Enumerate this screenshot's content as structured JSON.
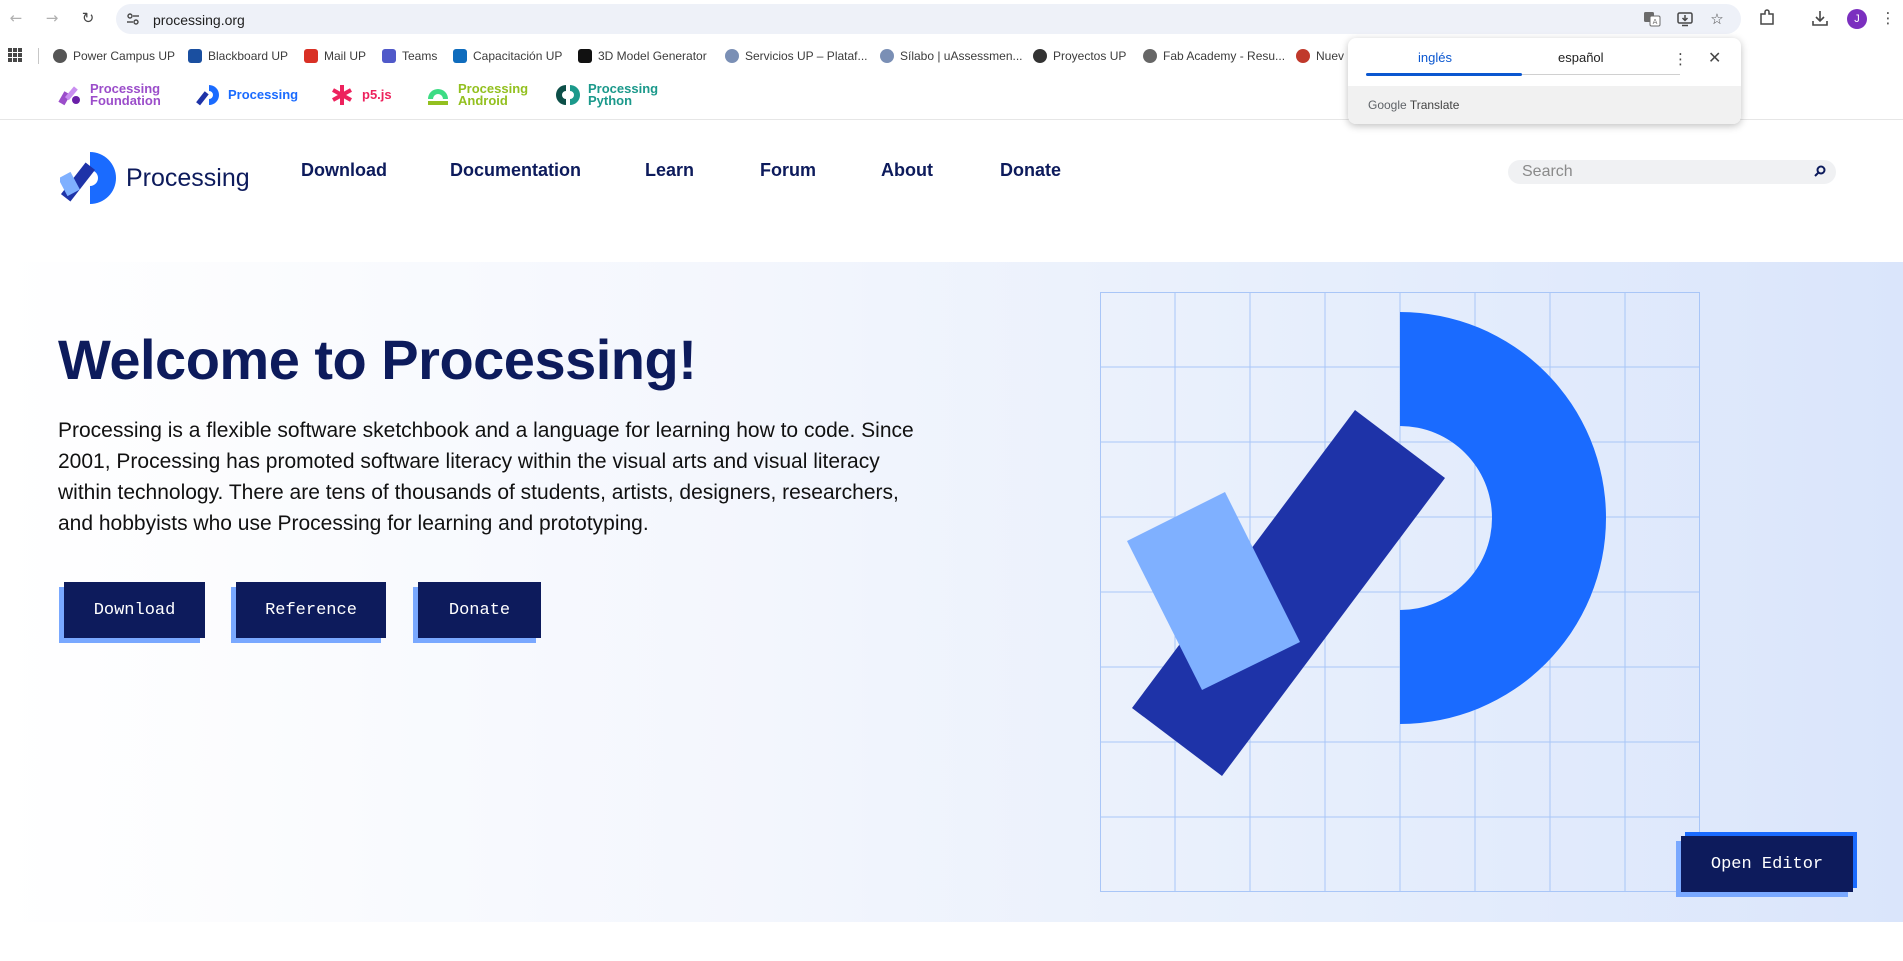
{
  "browser": {
    "url": "processing.org",
    "avatar_letter": "J",
    "icons": [
      "back-icon",
      "forward-icon",
      "reload-icon",
      "site-settings-icon",
      "translate-icon",
      "install-icon",
      "star-icon",
      "extensions-icon",
      "downloads-icon"
    ]
  },
  "bookmarks": [
    {
      "label": "Power Campus UP",
      "color": "#555555"
    },
    {
      "label": "Blackboard UP",
      "color": "#1a4fa0"
    },
    {
      "label": "Mail UP",
      "color": "#d93025"
    },
    {
      "label": "Teams",
      "color": "#5059c9"
    },
    {
      "label": "Capacitación UP",
      "color": "#0f6cbd"
    },
    {
      "label": "3D Model Generator",
      "color": "#111111"
    },
    {
      "label": "Servicios UP – Plataf...",
      "color": "#7a8fb5"
    },
    {
      "label": "Sílabo | uAssessmen...",
      "color": "#7a8fb5"
    },
    {
      "label": "Proyectos UP",
      "color": "#333333"
    },
    {
      "label": "Fab Academy - Resu...",
      "color": "#666666"
    },
    {
      "label": "Nuev",
      "color": "#c0392b"
    }
  ],
  "sites": [
    {
      "label_line1": "Processing",
      "label_line2": "Foundation",
      "color": "#9b4dca"
    },
    {
      "label_line1": "Processing",
      "label_line2": "",
      "color": "#1a6bff"
    },
    {
      "label_line1": "p5.js",
      "label_line2": "",
      "color": "#ed225d"
    },
    {
      "label_line1": "Processing",
      "label_line2": "Android",
      "color": "#93c01f"
    },
    {
      "label_line1": "Processing",
      "label_line2": "Python",
      "color": "#1b998b"
    }
  ],
  "header": {
    "brand": "Processing",
    "nav": [
      "Download",
      "Documentation",
      "Learn",
      "Forum",
      "About",
      "Donate"
    ],
    "search_placeholder": "Search"
  },
  "hero": {
    "title": "Welcome to Processing!",
    "text": "Processing is a flexible software sketchbook and a language for learning how to code. Since 2001, Processing has promoted software literacy within the visual arts and visual literacy within technology. There are tens of thousands of students, artists, designers, researchers, and hobbyists who use Processing for learning and prototyping.",
    "buttons": [
      "Download",
      "Reference",
      "Donate"
    ],
    "editor_button": "Open Editor"
  },
  "translate_popup": {
    "source_lang": "inglés",
    "target_lang": "español",
    "footer_brand": "Google",
    "footer_product": "Translate"
  },
  "colors": {
    "navy": "#0d1b5c",
    "blue": "#1a6bff",
    "dark_blue": "#1e33a8",
    "light_blue": "#7fb0ff"
  }
}
